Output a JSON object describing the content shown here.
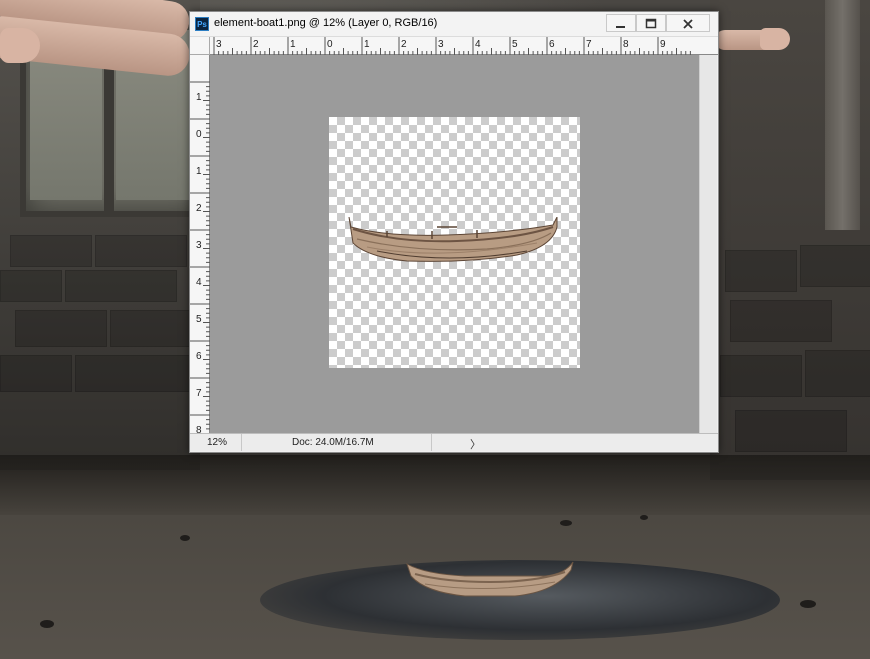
{
  "window": {
    "app_icon_label": "Ps",
    "title": "element-boat1.png @ 12% (Layer 0, RGB/16)"
  },
  "ruler_horizontal": [
    "3",
    "2",
    "1",
    "0",
    "1",
    "2",
    "3",
    "4",
    "5",
    "6",
    "7",
    "8",
    "9"
  ],
  "ruler_vertical": [
    "1",
    "0",
    "1",
    "2",
    "3",
    "4",
    "5",
    "6",
    "7",
    "8"
  ],
  "status": {
    "zoom": "12%",
    "doc_size": "Doc: 24.0M/16.7M",
    "menu_arrow": "〉"
  },
  "colors": {
    "canvas_gray": "#9b9b9b",
    "photoshop_blue": "#45a8ff"
  },
  "icons": [
    "minimize-icon",
    "maximize-icon",
    "close-icon",
    "boat-icon"
  ]
}
